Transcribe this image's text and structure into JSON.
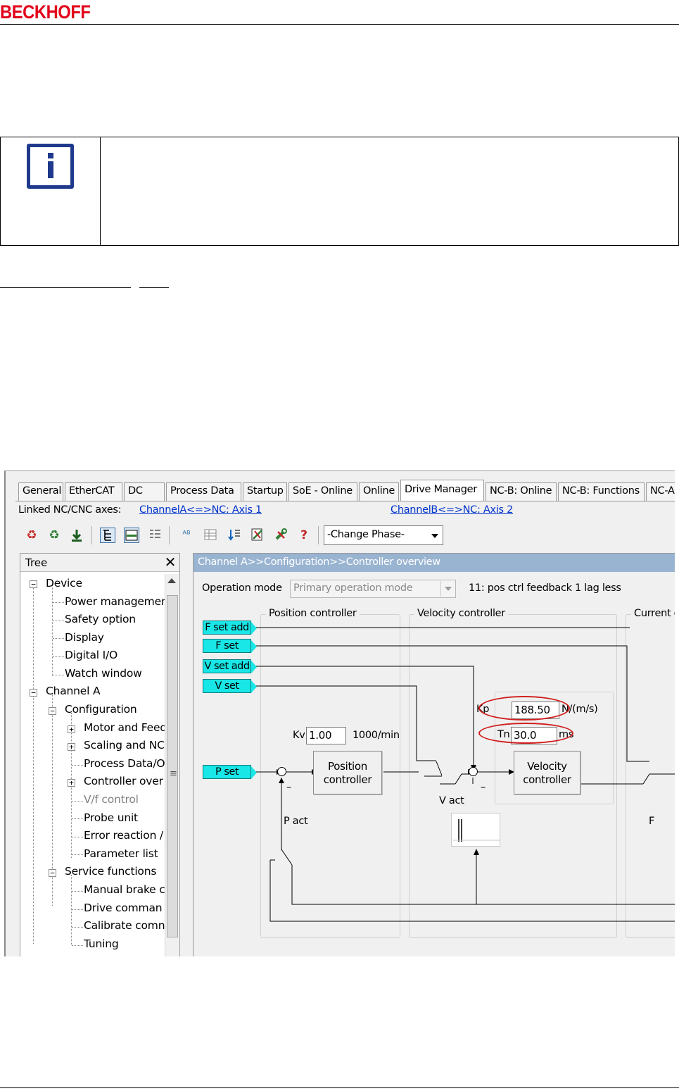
{
  "page": {
    "brand": "BECKHOFF"
  },
  "screenshot": {
    "tabs": [
      "General",
      "EtherCAT",
      "DC",
      "Process Data",
      "Startup",
      "SoE - Online",
      "Online",
      "Drive Manager",
      "NC-B: Online",
      "NC-B: Functions",
      "NC-A"
    ],
    "active_tab": "Drive Manager",
    "linked_label": "Linked NC/CNC axes:",
    "link_a": "ChannelA<=>NC: Axis 1",
    "link_b": "ChannelB<=>NC: Axis 2",
    "toolbar": {
      "icons": [
        "reload-red-icon",
        "reload-green-icon",
        "download-icon",
        "tree-view-icon",
        "panel-view-icon",
        "list-view-icon",
        "translate-icon",
        "table-icon",
        "import-icon",
        "export-icon",
        "tools-icon",
        "help-icon"
      ],
      "help_glyph": "?",
      "phase_select": "-Change Phase-"
    },
    "tree": {
      "title": "Tree",
      "close_glyph": "✕",
      "scroll_grip": "≡",
      "items": [
        {
          "label": "Device"
        },
        {
          "label": "Power managemen"
        },
        {
          "label": "Safety option"
        },
        {
          "label": "Display"
        },
        {
          "label": "Digital I/O"
        },
        {
          "label": "Watch window"
        },
        {
          "label": "Channel A"
        },
        {
          "label": "Configuration"
        },
        {
          "label": "Motor and Feed"
        },
        {
          "label": "Scaling and NC"
        },
        {
          "label": "Process Data/O"
        },
        {
          "label": "Controller over"
        },
        {
          "label": "V/f control"
        },
        {
          "label": "Probe unit"
        },
        {
          "label": "Error reaction /"
        },
        {
          "label": "Parameter list"
        },
        {
          "label": "Service functions"
        },
        {
          "label": "Manual brake c"
        },
        {
          "label": "Drive comman"
        },
        {
          "label": "Calibrate comn"
        },
        {
          "label": "Tuning"
        }
      ]
    },
    "content": {
      "breadcrumb": "Channel A>>Configuration>>Controller overview",
      "operation_mode_label": "Operation mode",
      "operation_mode_value": "Primary operation mode",
      "operation_mode_info": "11: pos ctrl feedback 1 lag less",
      "groups": {
        "position": "Position controller",
        "velocity": "Velocity controller",
        "current": "Current co"
      },
      "pins": [
        "F set add",
        "F set",
        "V set add",
        "V set",
        "P set"
      ],
      "kv_label": "Kv",
      "kv_value": "1.00",
      "kv_unit": "1000/min",
      "kp_label": "Kp",
      "kp_value": "188.50",
      "kp_unit": "N/(m/s)",
      "tn_label": "Tn",
      "tn_value": "30.0",
      "tn_unit": "ms",
      "position_block": "Position controller",
      "velocity_block": "Velocity controller",
      "p_act": "P act",
      "v_act": "V act",
      "f_label": "F",
      "minus": "–",
      "highlight_color": "#d01f1f",
      "pin_color": "#19e6e6",
      "title_bar_color": "#99b4d1"
    }
  }
}
